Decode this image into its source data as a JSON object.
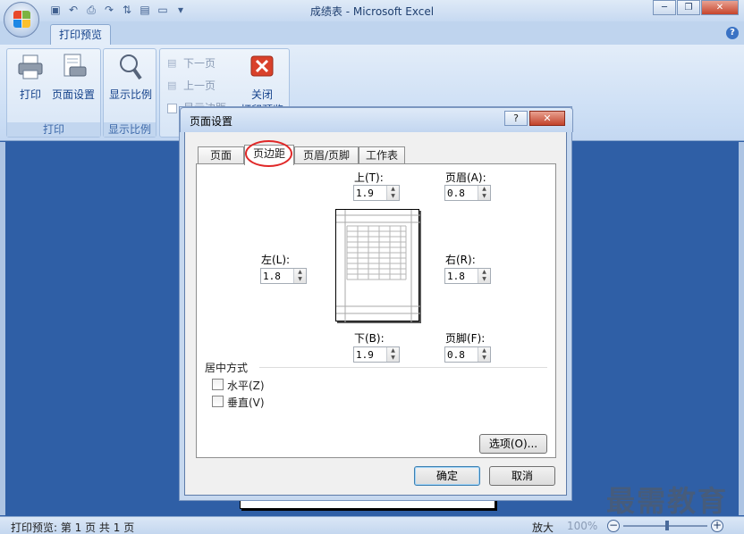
{
  "window": {
    "title": "成绩表 - Microsoft Excel",
    "controls": {
      "minimize": "─",
      "restore": "❐",
      "close": "✕"
    }
  },
  "ribbon": {
    "tab": "打印预览",
    "groups": {
      "print": {
        "label": "打印",
        "print_button": "打印",
        "page_setup_button": "页面设置"
      },
      "zoom": {
        "label": "显示比例",
        "zoom_button": "显示比例"
      },
      "preview": {
        "next_page": "下一页",
        "prev_page": "上一页",
        "show_margins": "显示边距",
        "close_line1": "关闭",
        "close_line2": "打印预览"
      }
    }
  },
  "dialog": {
    "title": "页面设置",
    "help": "?",
    "close": "✕",
    "tabs": [
      "页面",
      "页边距",
      "页眉/页脚",
      "工作表"
    ],
    "active_tab": "页边距",
    "margins": {
      "top_label": "上(T):",
      "top_value": "1.9",
      "header_label": "页眉(A):",
      "header_value": "0.8",
      "left_label": "左(L):",
      "left_value": "1.8",
      "right_label": "右(R):",
      "right_value": "1.8",
      "bottom_label": "下(B):",
      "bottom_value": "1.9",
      "footer_label": "页脚(F):",
      "footer_value": "0.8"
    },
    "centering": {
      "label": "居中方式",
      "horizontal": "水平(Z)",
      "vertical": "垂直(V)",
      "horizontal_checked": false,
      "vertical_checked": false
    },
    "options_button": "选项(O)...",
    "ok_button": "确定",
    "cancel_button": "取消"
  },
  "status": {
    "text": "打印预览: 第 1 页 共 1 页",
    "zoom_in_label": "放大",
    "zoom_level": "100%",
    "zoom_minus": "−",
    "zoom_plus": "+"
  },
  "watermark": "最需教育",
  "colors": {
    "accent": "#15428b",
    "highlight_circle": "#e02828",
    "preview_bg": "#2f5fa6"
  }
}
